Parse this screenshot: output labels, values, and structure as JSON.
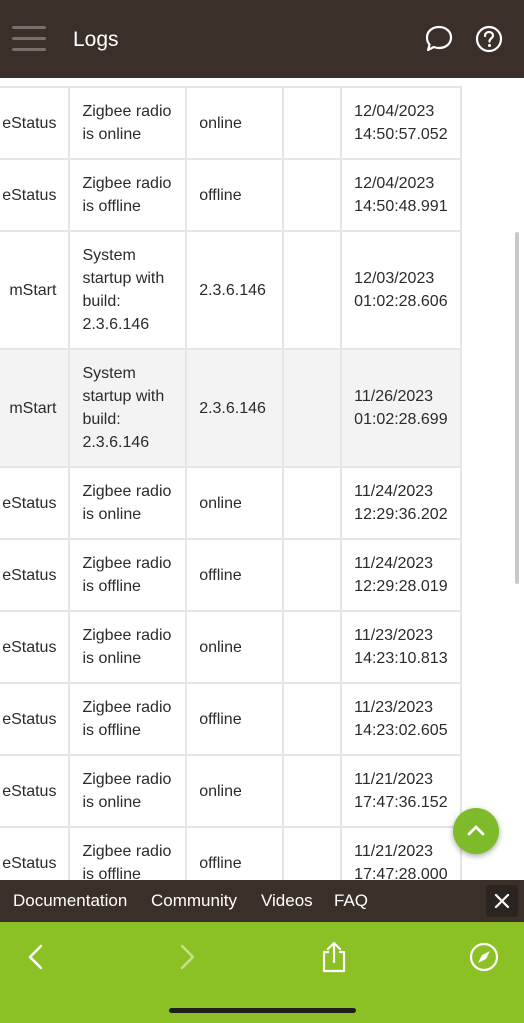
{
  "header": {
    "title": "Logs"
  },
  "icons": {
    "menu": "hamburger-icon",
    "chat": "chat-bubble-icon",
    "help": "help-icon",
    "scroll_top": "chevron-up-icon",
    "close": "close-icon",
    "back": "arrow-left-icon",
    "forward": "arrow-right-icon",
    "share": "share-icon",
    "compass": "compass-icon"
  },
  "logs": {
    "rows": [
      {
        "name": "eStatus",
        "description": [
          "Zigbee radio",
          "is online"
        ],
        "value": "online",
        "extra": "",
        "time": [
          "12/04/2023",
          "14:50:57.052"
        ]
      },
      {
        "name": "eStatus",
        "description": [
          "Zigbee radio",
          "is offline"
        ],
        "value": "offline",
        "extra": "",
        "time": [
          "12/04/2023",
          "14:50:48.991"
        ]
      },
      {
        "name": "mStart",
        "description": [
          "System",
          "startup with",
          "build:",
          "2.3.6.146"
        ],
        "value": "2.3.6.146",
        "extra": "",
        "time": [
          "12/03/2023",
          "01:02:28.606"
        ]
      },
      {
        "name": "mStart",
        "description": [
          "System",
          "startup with",
          "build:",
          "2.3.6.146"
        ],
        "value": "2.3.6.146",
        "extra": "",
        "time": [
          "11/26/2023",
          "01:02:28.699"
        ]
      },
      {
        "name": "eStatus",
        "description": [
          "Zigbee radio",
          "is online"
        ],
        "value": "online",
        "extra": "",
        "time": [
          "11/24/2023",
          "12:29:36.202"
        ]
      },
      {
        "name": "eStatus",
        "description": [
          "Zigbee radio",
          "is offline"
        ],
        "value": "offline",
        "extra": "",
        "time": [
          "11/24/2023",
          "12:29:28.019"
        ]
      },
      {
        "name": "eStatus",
        "description": [
          "Zigbee radio",
          "is online"
        ],
        "value": "online",
        "extra": "",
        "time": [
          "11/23/2023",
          "14:23:10.813"
        ]
      },
      {
        "name": "eStatus",
        "description": [
          "Zigbee radio",
          "is offline"
        ],
        "value": "offline",
        "extra": "",
        "time": [
          "11/23/2023",
          "14:23:02.605"
        ]
      },
      {
        "name": "eStatus",
        "description": [
          "Zigbee radio",
          "is online"
        ],
        "value": "online",
        "extra": "",
        "time": [
          "11/21/2023",
          "17:47:36.152"
        ]
      },
      {
        "name": "eStatus",
        "description": [
          "Zigbee radio",
          "is offline"
        ],
        "value": "offline",
        "extra": "",
        "time": [
          "11/21/2023",
          "17:47:28.000"
        ]
      }
    ]
  },
  "footer_links": [
    "Documentation",
    "Community",
    "Videos",
    "FAQ"
  ],
  "colors": {
    "header_bg": "#3b2f2a",
    "accent_green": "#8bc124",
    "fab_green": "#7dbb2a"
  }
}
